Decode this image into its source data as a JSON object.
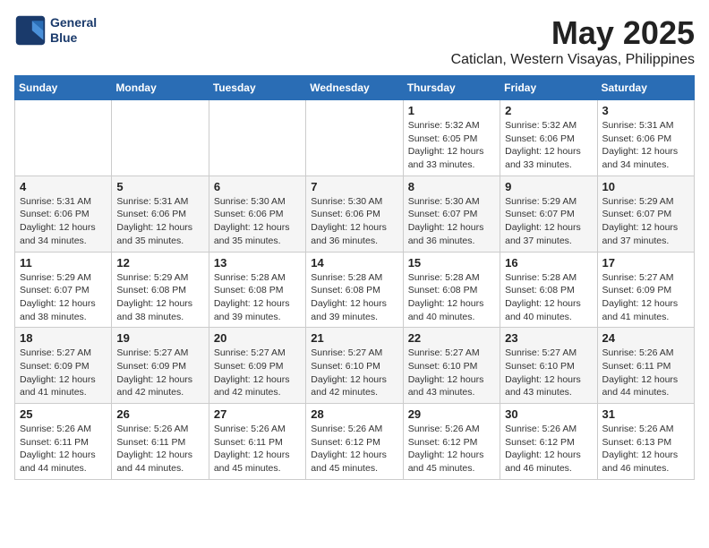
{
  "header": {
    "logo_line1": "General",
    "logo_line2": "Blue",
    "title": "May 2025",
    "subtitle": "Caticlan, Western Visayas, Philippines"
  },
  "days_of_week": [
    "Sunday",
    "Monday",
    "Tuesday",
    "Wednesday",
    "Thursday",
    "Friday",
    "Saturday"
  ],
  "weeks": [
    [
      {
        "day": "",
        "content": ""
      },
      {
        "day": "",
        "content": ""
      },
      {
        "day": "",
        "content": ""
      },
      {
        "day": "",
        "content": ""
      },
      {
        "day": "1",
        "content": "Sunrise: 5:32 AM\nSunset: 6:05 PM\nDaylight: 12 hours\nand 33 minutes."
      },
      {
        "day": "2",
        "content": "Sunrise: 5:32 AM\nSunset: 6:06 PM\nDaylight: 12 hours\nand 33 minutes."
      },
      {
        "day": "3",
        "content": "Sunrise: 5:31 AM\nSunset: 6:06 PM\nDaylight: 12 hours\nand 34 minutes."
      }
    ],
    [
      {
        "day": "4",
        "content": "Sunrise: 5:31 AM\nSunset: 6:06 PM\nDaylight: 12 hours\nand 34 minutes."
      },
      {
        "day": "5",
        "content": "Sunrise: 5:31 AM\nSunset: 6:06 PM\nDaylight: 12 hours\nand 35 minutes."
      },
      {
        "day": "6",
        "content": "Sunrise: 5:30 AM\nSunset: 6:06 PM\nDaylight: 12 hours\nand 35 minutes."
      },
      {
        "day": "7",
        "content": "Sunrise: 5:30 AM\nSunset: 6:06 PM\nDaylight: 12 hours\nand 36 minutes."
      },
      {
        "day": "8",
        "content": "Sunrise: 5:30 AM\nSunset: 6:07 PM\nDaylight: 12 hours\nand 36 minutes."
      },
      {
        "day": "9",
        "content": "Sunrise: 5:29 AM\nSunset: 6:07 PM\nDaylight: 12 hours\nand 37 minutes."
      },
      {
        "day": "10",
        "content": "Sunrise: 5:29 AM\nSunset: 6:07 PM\nDaylight: 12 hours\nand 37 minutes."
      }
    ],
    [
      {
        "day": "11",
        "content": "Sunrise: 5:29 AM\nSunset: 6:07 PM\nDaylight: 12 hours\nand 38 minutes."
      },
      {
        "day": "12",
        "content": "Sunrise: 5:29 AM\nSunset: 6:08 PM\nDaylight: 12 hours\nand 38 minutes."
      },
      {
        "day": "13",
        "content": "Sunrise: 5:28 AM\nSunset: 6:08 PM\nDaylight: 12 hours\nand 39 minutes."
      },
      {
        "day": "14",
        "content": "Sunrise: 5:28 AM\nSunset: 6:08 PM\nDaylight: 12 hours\nand 39 minutes."
      },
      {
        "day": "15",
        "content": "Sunrise: 5:28 AM\nSunset: 6:08 PM\nDaylight: 12 hours\nand 40 minutes."
      },
      {
        "day": "16",
        "content": "Sunrise: 5:28 AM\nSunset: 6:08 PM\nDaylight: 12 hours\nand 40 minutes."
      },
      {
        "day": "17",
        "content": "Sunrise: 5:27 AM\nSunset: 6:09 PM\nDaylight: 12 hours\nand 41 minutes."
      }
    ],
    [
      {
        "day": "18",
        "content": "Sunrise: 5:27 AM\nSunset: 6:09 PM\nDaylight: 12 hours\nand 41 minutes."
      },
      {
        "day": "19",
        "content": "Sunrise: 5:27 AM\nSunset: 6:09 PM\nDaylight: 12 hours\nand 42 minutes."
      },
      {
        "day": "20",
        "content": "Sunrise: 5:27 AM\nSunset: 6:09 PM\nDaylight: 12 hours\nand 42 minutes."
      },
      {
        "day": "21",
        "content": "Sunrise: 5:27 AM\nSunset: 6:10 PM\nDaylight: 12 hours\nand 42 minutes."
      },
      {
        "day": "22",
        "content": "Sunrise: 5:27 AM\nSunset: 6:10 PM\nDaylight: 12 hours\nand 43 minutes."
      },
      {
        "day": "23",
        "content": "Sunrise: 5:27 AM\nSunset: 6:10 PM\nDaylight: 12 hours\nand 43 minutes."
      },
      {
        "day": "24",
        "content": "Sunrise: 5:26 AM\nSunset: 6:11 PM\nDaylight: 12 hours\nand 44 minutes."
      }
    ],
    [
      {
        "day": "25",
        "content": "Sunrise: 5:26 AM\nSunset: 6:11 PM\nDaylight: 12 hours\nand 44 minutes."
      },
      {
        "day": "26",
        "content": "Sunrise: 5:26 AM\nSunset: 6:11 PM\nDaylight: 12 hours\nand 44 minutes."
      },
      {
        "day": "27",
        "content": "Sunrise: 5:26 AM\nSunset: 6:11 PM\nDaylight: 12 hours\nand 45 minutes."
      },
      {
        "day": "28",
        "content": "Sunrise: 5:26 AM\nSunset: 6:12 PM\nDaylight: 12 hours\nand 45 minutes."
      },
      {
        "day": "29",
        "content": "Sunrise: 5:26 AM\nSunset: 6:12 PM\nDaylight: 12 hours\nand 45 minutes."
      },
      {
        "day": "30",
        "content": "Sunrise: 5:26 AM\nSunset: 6:12 PM\nDaylight: 12 hours\nand 46 minutes."
      },
      {
        "day": "31",
        "content": "Sunrise: 5:26 AM\nSunset: 6:13 PM\nDaylight: 12 hours\nand 46 minutes."
      }
    ]
  ]
}
